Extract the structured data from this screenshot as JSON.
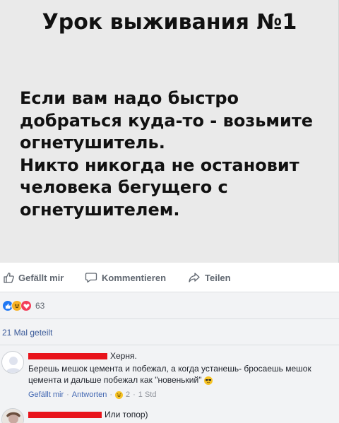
{
  "meme": {
    "title": "Урок выживания №1",
    "lines": [
      "Если вам надо быстро",
      "добраться куда-то - возьмите",
      "огнетушитель.",
      "Никто никогда не остановит",
      "человека бегущего с",
      "огнетушителем."
    ]
  },
  "actions": {
    "like": "Gefällt mir",
    "comment": "Kommentieren",
    "share": "Teilen"
  },
  "reactions": {
    "icons": [
      "like-reaction",
      "haha-reaction",
      "love-reaction"
    ],
    "count": "63"
  },
  "shares": "21 Mal geteilt",
  "comments": [
    {
      "author_visible": "Херня.",
      "text": "Берешь мешок цемента и побежал, а когда устанешь- бросаешь мешок цемента и дальше побежал как \"новенький\"",
      "emoji": "sunglasses-emoji",
      "like_label": "Gefällt mir",
      "reply_label": "Antworten",
      "reaction_count": "2",
      "time": "1 Std"
    },
    {
      "author_visible": "Или топор)"
    }
  ],
  "colors": {
    "redaction": "#e8131b",
    "link": "#385898",
    "like_reaction": "#2078f4",
    "haha_reaction": "#f7b125",
    "love_reaction": "#f33e58"
  }
}
